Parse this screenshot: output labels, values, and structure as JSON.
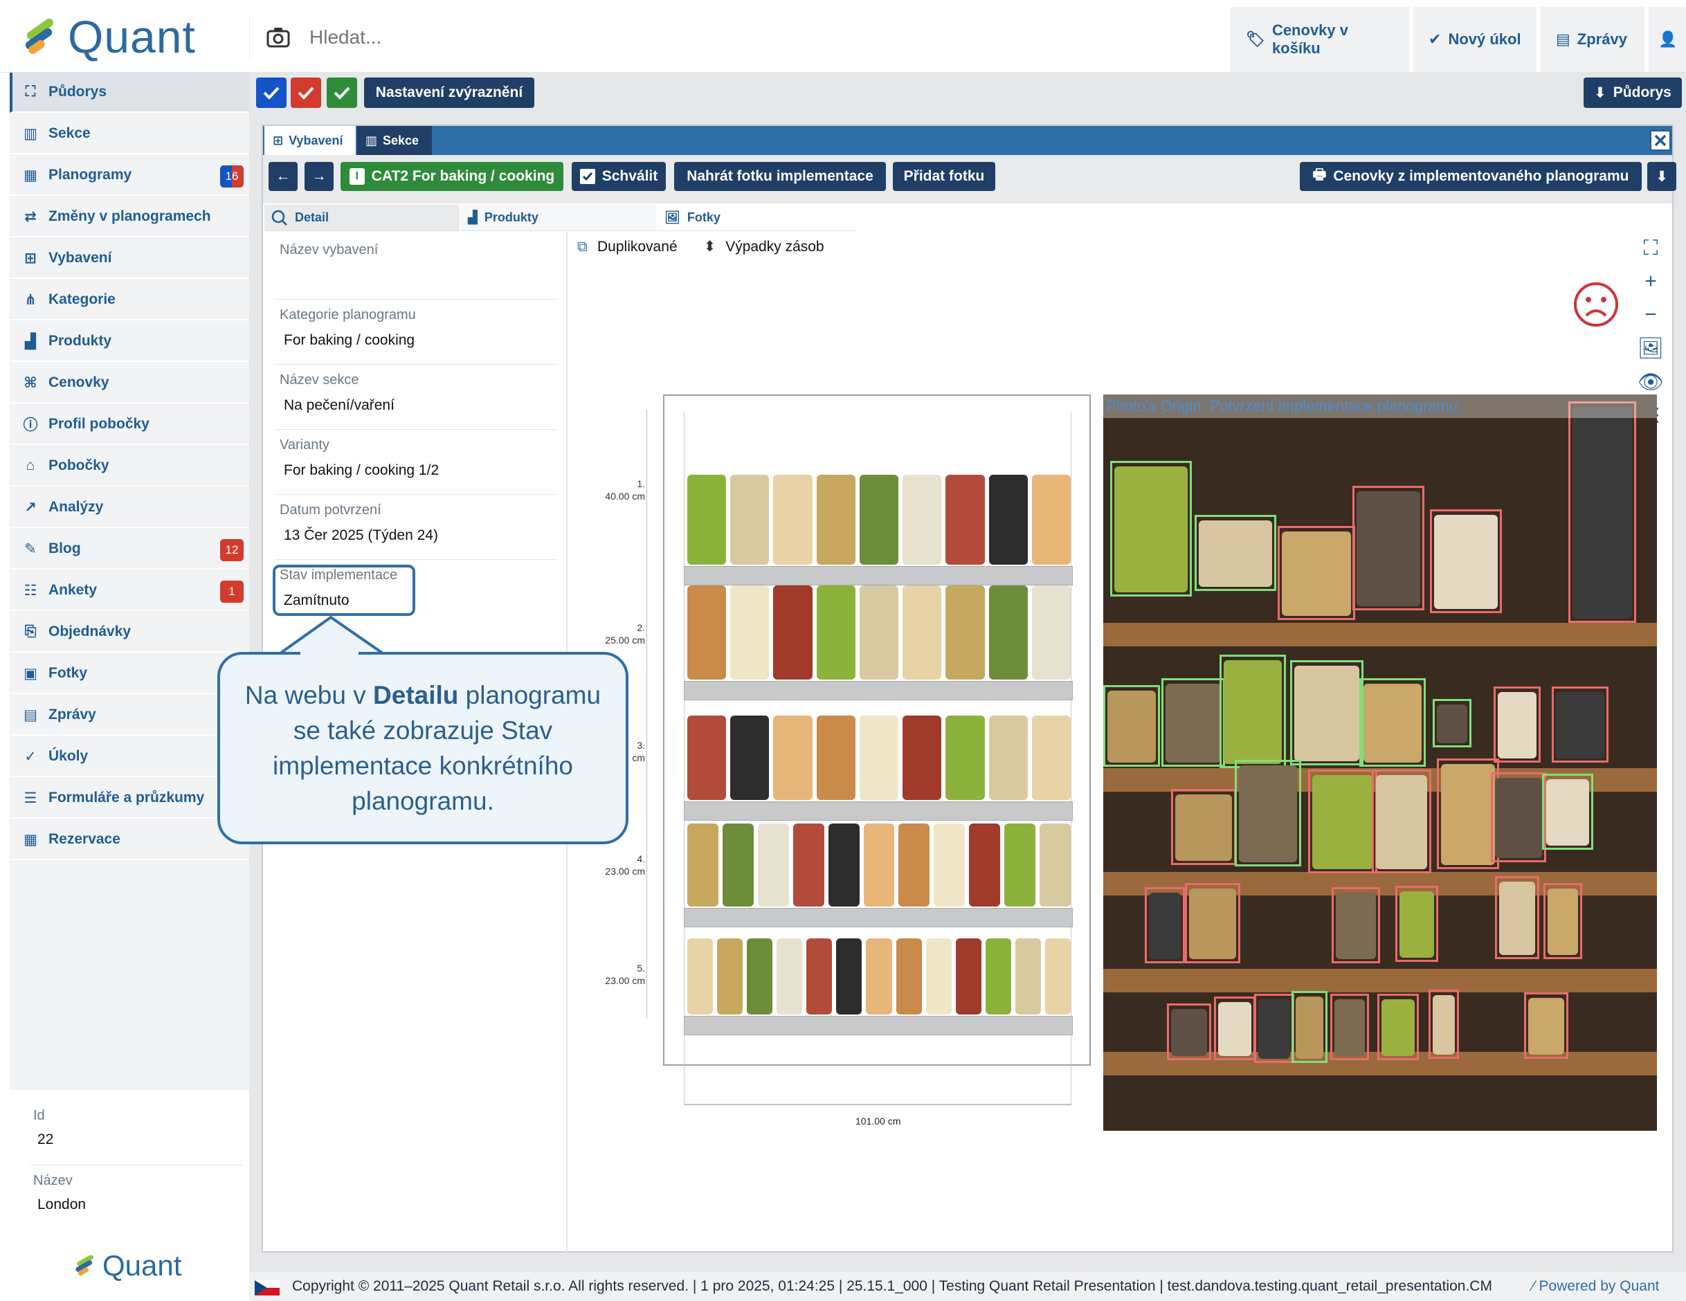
{
  "app": {
    "logo_text": "Quant",
    "search_placeholder": "Hledat..."
  },
  "topbar": {
    "cart": "Cenovky v košíku",
    "new_task": "Nový úkol",
    "messages": "Zprávy"
  },
  "sidebar": {
    "items": [
      {
        "label": "Půdorys",
        "icon": "floorplan-icon"
      },
      {
        "label": "Sekce",
        "icon": "sections-icon"
      },
      {
        "label": "Planogramy",
        "icon": "planogram-icon",
        "badge": "16"
      },
      {
        "label": "Změny v planogramech",
        "icon": "changes-icon"
      },
      {
        "label": "Vybavení",
        "icon": "equipment-icon"
      },
      {
        "label": "Kategorie",
        "icon": "category-icon"
      },
      {
        "label": "Produkty",
        "icon": "products-icon"
      },
      {
        "label": "Cenovky",
        "icon": "price-tag-icon"
      },
      {
        "label": "Profil pobočky",
        "icon": "info-icon"
      },
      {
        "label": "Pobočky",
        "icon": "home-icon"
      },
      {
        "label": "Analýzy",
        "icon": "chart-icon"
      },
      {
        "label": "Blog",
        "icon": "edit-icon",
        "badge": "12"
      },
      {
        "label": "Ankety",
        "icon": "survey-icon",
        "badge": "1"
      },
      {
        "label": "Objednávky",
        "icon": "orders-icon"
      },
      {
        "label": "Fotky",
        "icon": "photo-icon"
      },
      {
        "label": "Zprávy",
        "icon": "messages-icon"
      },
      {
        "label": "Úkoly",
        "icon": "check-circle-icon"
      },
      {
        "label": "Formuláře a průzkumy",
        "icon": "form-icon"
      },
      {
        "label": "Rezervace",
        "icon": "calendar-icon"
      }
    ]
  },
  "store_info": {
    "id_label": "Id",
    "id_value": "22",
    "name_label": "Název",
    "name_value": "London",
    "logo_text": "Quant"
  },
  "toolbar": {
    "highlight_settings": "Nastavení zvýraznění",
    "floorplan_button": "Půdorys"
  },
  "panel": {
    "tab_equipment": "Vybavení",
    "tab_sections": "Sekce",
    "category_badge": "I",
    "category_label": "CAT2 For baking / cooking",
    "approve": "Schválit",
    "upload_photo": "Nahrát fotku implementace",
    "add_photo": "Přidat fotku",
    "price_tags": "Cenovky z implementovaného planogramu",
    "subtab_detail": "Detail",
    "subtab_products": "Produkty",
    "subtab_photos": "Fotky"
  },
  "details": {
    "equipment_name_label": "Název vybavení",
    "equipment_name_value": "",
    "category_label": "Kategorie planogramu",
    "category_value": "For baking / cooking",
    "section_label": "Název sekce",
    "section_value": "Na pečení/vaření",
    "variants_label": "Varianty",
    "variants_value": "For baking / cooking 1/2",
    "confirmed_label": "Datum potvrzení",
    "confirmed_value": "13 Čer 2025 (Týden 24)",
    "status_label": "Stav implementace",
    "status_value": "Zamítnuto"
  },
  "legend": {
    "duplicated": "Duplikované",
    "stockouts": "Výpadky zásob"
  },
  "planogram": {
    "shelves": [
      {
        "num": "1.",
        "height": "40.00 cm"
      },
      {
        "num": "2.",
        "height": "25.00 cm"
      },
      {
        "num": "3.",
        "height": "cm"
      },
      {
        "num": "4.",
        "height": "23.00 cm"
      },
      {
        "num": "5.",
        "height": "23.00 cm"
      }
    ],
    "width": "101.00 cm"
  },
  "photo": {
    "origin": "Photo's Origin: Potvrzení implementace planogramu"
  },
  "callout": {
    "pre": "Na webu v ",
    "bold": "Detailu",
    "post": " planogramu se také zobrazuje Stav implementace konkrétního planogramu."
  },
  "footer": {
    "text": "Copyright © 2011–2025 Quant Retail s.r.o. All rights reserved. | 1 pro 2025, 01:24:25 | 25.15.1_000 | Testing Quant Retail Presentation | test.dandova.testing.quant_retail_presentation.CM",
    "powered": "Powered by Quant"
  },
  "colors": {
    "brand": "#1f5d94",
    "dark_button": "#1f3f66",
    "panel_bar": "#2f6fa8",
    "green": "#2e8b3a",
    "red": "#d33b2f",
    "blue_check": "#1454c8",
    "match_box": "#7ee07a",
    "mismatch_box": "#ea6b6b"
  }
}
